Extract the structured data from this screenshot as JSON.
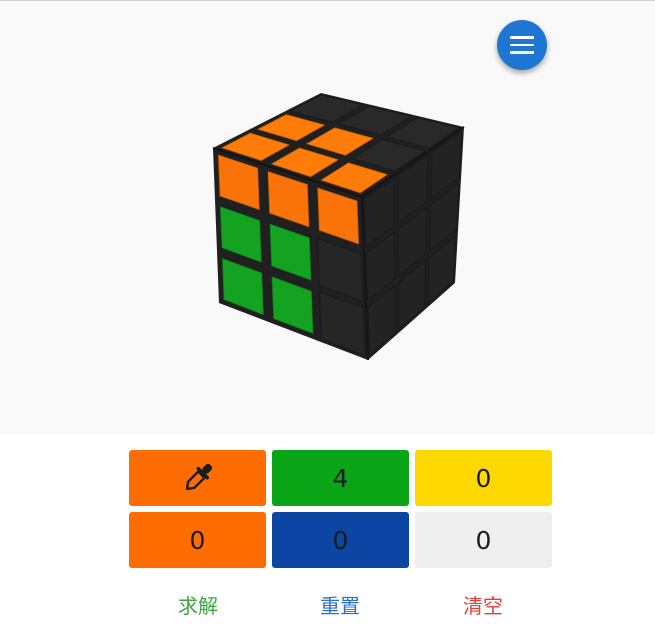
{
  "menu": {
    "icon": "hamburger-menu-icon"
  },
  "cube": {
    "colors": {
      "orange": "#f97308",
      "green": "#14a321",
      "body": "#202020"
    },
    "top_face": [
      [
        "body",
        "body",
        "body"
      ],
      [
        "orange",
        "orange",
        "body"
      ],
      [
        "orange",
        "orange",
        "orange"
      ]
    ],
    "front_face": [
      [
        "orange",
        "orange",
        "orange"
      ],
      [
        "green",
        "green",
        "body"
      ],
      [
        "green",
        "green",
        "body"
      ]
    ],
    "right_face": [
      [
        "body",
        "body",
        "body"
      ],
      [
        "body",
        "body",
        "body"
      ],
      [
        "body",
        "body",
        "body"
      ]
    ]
  },
  "palette": [
    {
      "key": "orange-1",
      "color": "#ff6c00",
      "content": "eyedropper",
      "selected": true
    },
    {
      "key": "green",
      "color": "#0aa517",
      "count": "4"
    },
    {
      "key": "yellow",
      "color": "#ffd800",
      "count": "0"
    },
    {
      "key": "orange-2",
      "color": "#ff6c00",
      "count": "0"
    },
    {
      "key": "blue",
      "color": "#0c45a3",
      "count": "0"
    },
    {
      "key": "white",
      "color": "#efefef",
      "count": "0"
    }
  ],
  "actions": {
    "solve": {
      "label": "求解",
      "color": "#3fa63f"
    },
    "reset": {
      "label": "重置",
      "color": "#2a72c8"
    },
    "clear": {
      "label": "清空",
      "color": "#e0403a"
    }
  }
}
